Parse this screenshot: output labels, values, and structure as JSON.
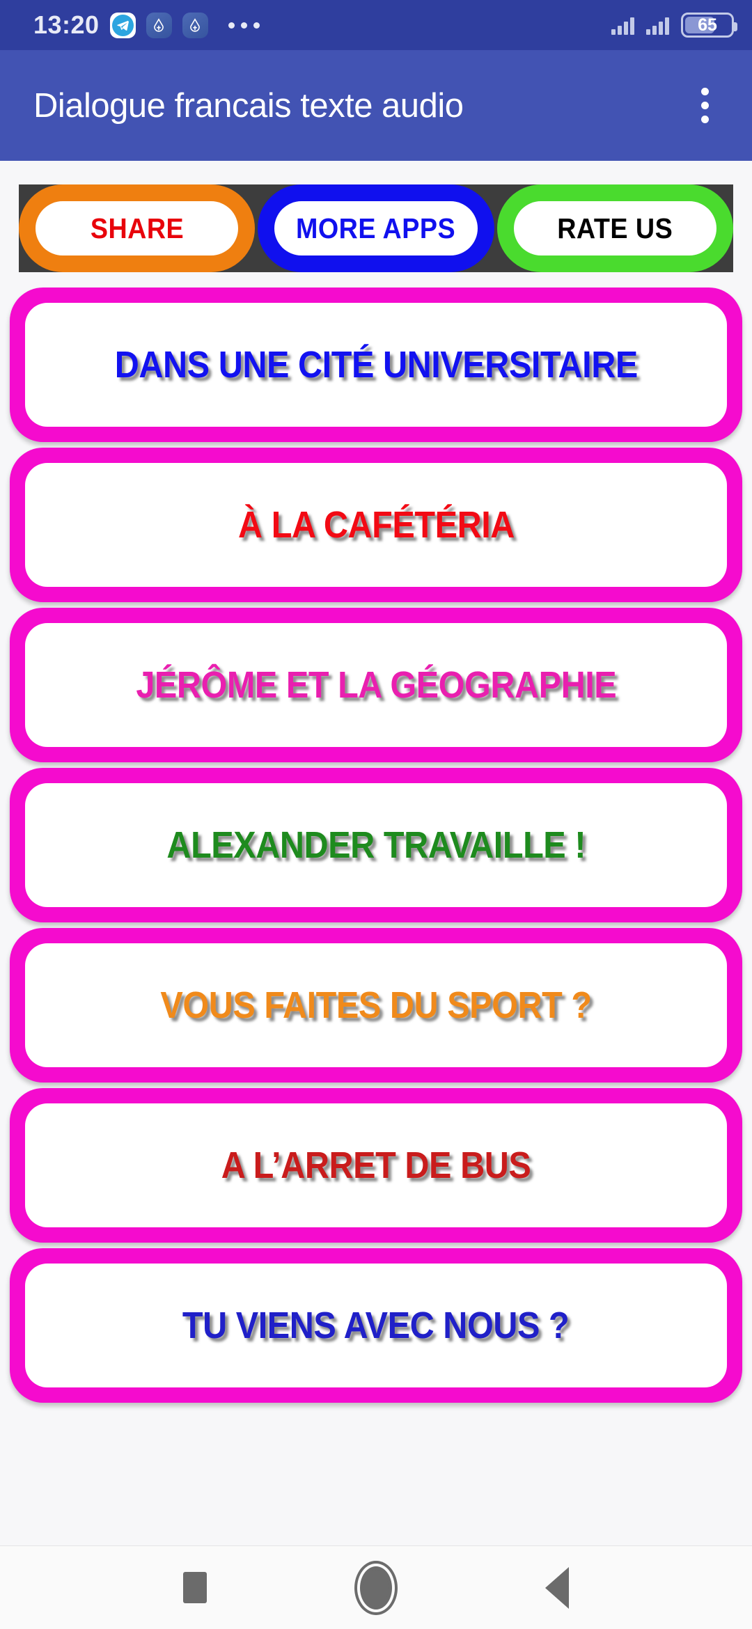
{
  "statusbar": {
    "clock": "13:20",
    "battery_level": "65",
    "icons": [
      "telegram-icon",
      "app-notification-icon",
      "app-notification-icon",
      "more-notifications-icon"
    ],
    "signal_bars": 2
  },
  "appbar": {
    "title": "Dialogue francais texte audio",
    "overflow_label": "overflow-menu"
  },
  "promobar": {
    "background": "#3D3D3D",
    "buttons": [
      {
        "label": "SHARE",
        "border_color": "#EF7F10",
        "text_color": "#E8030B"
      },
      {
        "label": "MORE APPS",
        "border_color": "#1010EE",
        "text_color": "#1010EE"
      },
      {
        "label": "RATE US",
        "border_color": "#4ADB2E",
        "text_color": "#000000"
      }
    ]
  },
  "list": {
    "card_border_color": "#F50BCE",
    "items": [
      {
        "label": "DANS UNE CITÉ UNIVERSITAIRE",
        "color": "#1212F0"
      },
      {
        "label": "À LA CAFÉTÉRIA",
        "color": "#F20A14"
      },
      {
        "label": "JÉRÔME ET LA GÉOGRAPHIE",
        "color": "#E91FAF"
      },
      {
        "label": "ALEXANDER TRAVAILLE !",
        "color": "#1E8B1E"
      },
      {
        "label": "VOUS FAITES DU SPORT ?",
        "color": "#F08A1B"
      },
      {
        "label": "A L’ARRET DE BUS",
        "color": "#C91C1C"
      },
      {
        "label": "TU VIENS AVEC NOUS ?",
        "color": "#2020C8"
      }
    ]
  },
  "navbar": {
    "buttons": [
      {
        "name": "recents-button"
      },
      {
        "name": "home-button"
      },
      {
        "name": "back-button"
      }
    ]
  }
}
